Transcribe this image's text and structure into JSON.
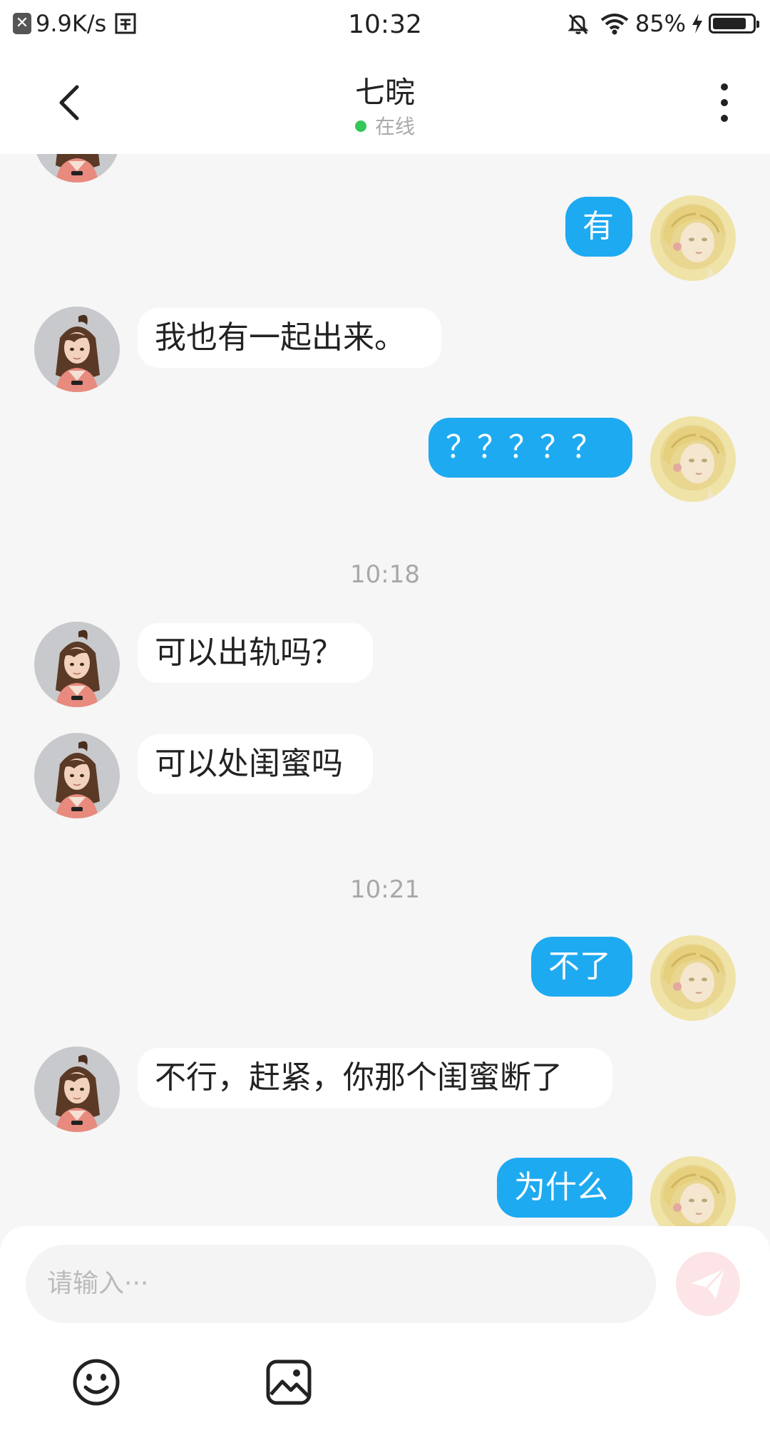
{
  "status_bar": {
    "net_speed": "9.9K/s",
    "time": "10:32",
    "battery": "85%",
    "battery_level": 0.85
  },
  "header": {
    "title": "七晥",
    "status": "在线",
    "status_color": "#34c759"
  },
  "messages": [
    {
      "side": "in",
      "text": "我也有一起出来。"
    },
    {
      "side": "out",
      "text": "有"
    },
    {
      "side": "out",
      "text": "？？？？？"
    },
    {
      "time": "10:18"
    },
    {
      "side": "in",
      "text": "可以出轨吗？"
    },
    {
      "side": "in",
      "text": "可以处闺蜜吗"
    },
    {
      "time": "10:21"
    },
    {
      "side": "out",
      "text": "不了"
    },
    {
      "side": "in",
      "text": "不行，赶紧，你那个闺蜜断了"
    },
    {
      "side": "out",
      "text": "为什么"
    }
  ],
  "input": {
    "placeholder": "请输入···"
  },
  "colors": {
    "outgoing_bubble": "#1eaaf1",
    "incoming_bubble": "#ffffff",
    "background": "#f6f6f6",
    "send_button": "#fde4e6"
  },
  "icons": {
    "back": "chevron-left-icon",
    "more": "more-vertical-icon",
    "send": "paper-plane-icon",
    "emoji": "smiley-icon",
    "image": "image-icon"
  }
}
